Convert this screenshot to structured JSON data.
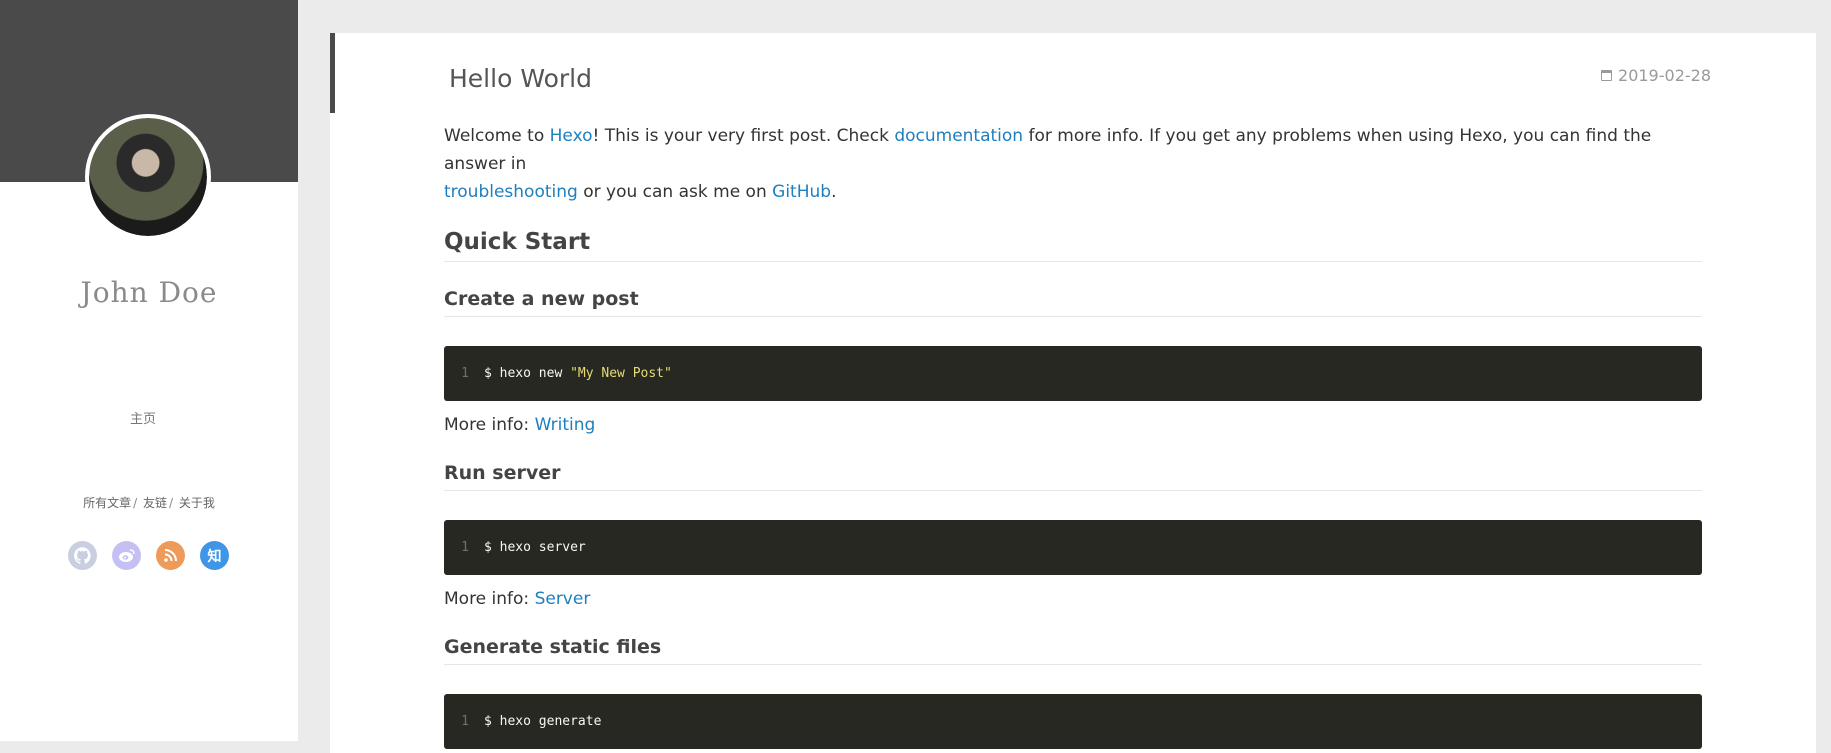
{
  "sidebar": {
    "author": "John Doe",
    "home": "主页",
    "links": [
      "所有文章",
      "友链",
      "关于我"
    ],
    "link_separator": "/",
    "social": [
      {
        "icon": "github-icon",
        "color": "#c9cfe0"
      },
      {
        "icon": "weibo-icon",
        "color": "#c5c0f3"
      },
      {
        "icon": "rss-icon",
        "color": "#ee9a5b"
      },
      {
        "icon": "zhihu-icon",
        "color": "#3f96e6",
        "label": "知"
      }
    ]
  },
  "post": {
    "title": "Hello World",
    "date": "2019-02-28",
    "intro": {
      "t1": "Welcome to ",
      "link_hexo": "Hexo",
      "t2": "! This is your very first post. Check ",
      "link_docs": "documentation",
      "t3": " for more info. If you get any problems when using Hexo, you can find the answer in",
      "link_trouble": "troubleshooting",
      "t4": " or you can ask me on ",
      "link_github": "GitHub",
      "t5": "."
    },
    "quick_start": "Quick Start",
    "sections": [
      {
        "heading": "Create a new post",
        "line": "1",
        "code_cmd": "$ hexo new ",
        "code_str": "\"My New Post\"",
        "more_label": "More info: ",
        "more_link": "Writing"
      },
      {
        "heading": "Run server",
        "line": "1",
        "code_cmd": "$ hexo server",
        "code_str": "",
        "more_label": "More info: ",
        "more_link": "Server"
      },
      {
        "heading": "Generate static files",
        "line": "1",
        "code_cmd": "$ hexo generate",
        "code_str": ""
      }
    ]
  }
}
